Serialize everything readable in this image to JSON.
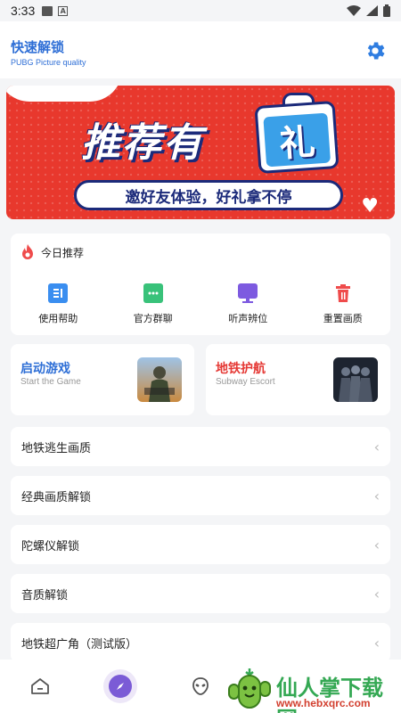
{
  "status_bar": {
    "time": "3:33",
    "icons": [
      "image-icon",
      "a-letter-icon",
      "wifi-icon",
      "signal-icon",
      "battery-icon"
    ]
  },
  "header": {
    "title": "快速解锁",
    "subtitle": "PUBG Picture quality"
  },
  "banner": {
    "headline": "推荐有",
    "gift_char": "礼",
    "caption": "邀好友体验，好礼拿不停"
  },
  "today": {
    "title": "今日推荐",
    "items": [
      {
        "label": "使用帮助",
        "icon": "help-doc-icon",
        "color": "#3a8ef0"
      },
      {
        "label": "官方群聊",
        "icon": "chat-icon",
        "color": "#39c27a"
      },
      {
        "label": "听声辨位",
        "icon": "monitor-icon",
        "color": "#7d5ae0"
      },
      {
        "label": "重置画质",
        "icon": "trash-icon",
        "color": "#ef4b4b"
      }
    ]
  },
  "games": [
    {
      "title": "启动游戏",
      "subtitle": "Start the Game",
      "color": "#2f6fd6"
    },
    {
      "title": "地铁护航",
      "subtitle": "Subway Escort",
      "color": "#e53935"
    }
  ],
  "menu": [
    {
      "label": "地铁逃生画质"
    },
    {
      "label": "经典画质解锁"
    },
    {
      "label": "陀螺仪解锁"
    },
    {
      "label": "音质解锁"
    },
    {
      "label": "地铁超广角（测试版）"
    }
  ],
  "chevron": "‹",
  "bottom_nav": [
    "home-icon",
    "compass-icon",
    "alien-icon"
  ],
  "watermark": {
    "title": "仙人掌下载网",
    "url": "www.hebxqrc.com"
  },
  "colors": {
    "accent": "#2f6fd6",
    "banner_red": "#e8382d",
    "nav_active": "#7b5bd6"
  }
}
